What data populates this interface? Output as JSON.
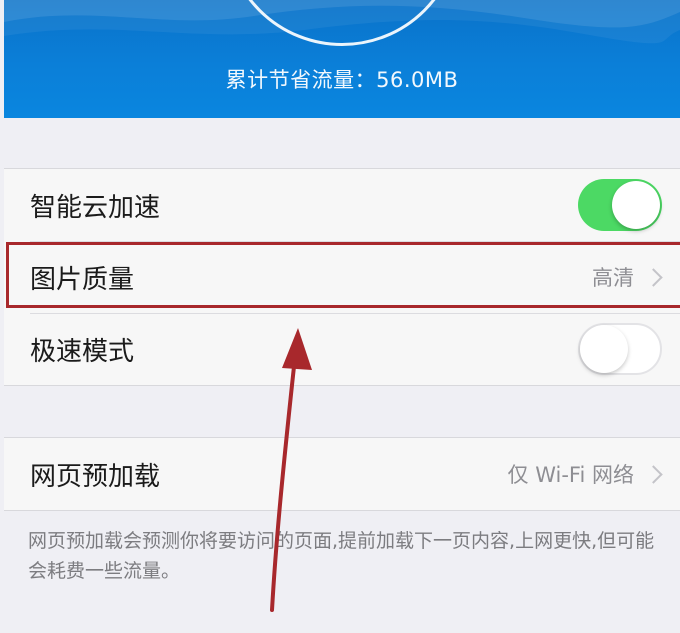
{
  "header": {
    "saved_text": "累计节省流量：56.0MB"
  },
  "settings": {
    "smart_cloud": {
      "label": "智能云加速",
      "enabled": true
    },
    "image_quality": {
      "label": "图片质量",
      "value": "高清"
    },
    "fast_mode": {
      "label": "极速模式",
      "enabled": false
    },
    "preload": {
      "label": "网页预加载",
      "value": "仅 Wi-Fi 网络"
    }
  },
  "footnote": "网页预加载会预测你将要访问的页面,提前加载下一页内容,上网更快,但可能会耗费一些流量。",
  "colors": {
    "header_blue": "#0b7fd8",
    "toggle_on": "#4cd964",
    "highlight_red": "#a8282c"
  }
}
